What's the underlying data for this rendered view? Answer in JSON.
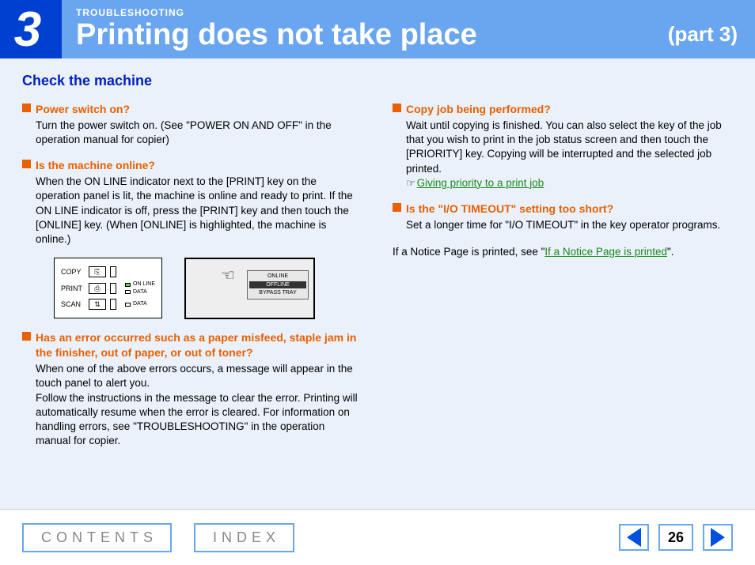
{
  "header": {
    "chapter_number": "3",
    "breadcrumb": "TROUBLESHOOTING",
    "title": "Printing does not take place",
    "part": "(part 3)"
  },
  "subheading": "Check the machine",
  "left_items": [
    {
      "title": "Power switch on?",
      "body": "Turn the power switch on. (See \"POWER ON AND OFF\" in the operation manual for copier)"
    },
    {
      "title": "Is the machine online?",
      "body": "When the ON LINE indicator next to the [PRINT] key on the operation panel is lit, the machine is online and ready to print. If the ON LINE indicator is off, press the [PRINT] key and then touch the [ONLINE] key. (When [ONLINE] is highlighted, the machine is online.)"
    },
    {
      "title": "Has an error occurred such as a paper misfeed, staple jam in the finisher, out of paper, or out of toner?",
      "body": "When one of the above errors occurs, a message will appear in the touch panel to alert you.\nFollow the instructions in the message to clear the error. Printing will automatically resume when the error is cleared. For information on handling errors, see \"TROUBLESHOOTING\" in the operation manual for copier."
    }
  ],
  "right_items": [
    {
      "title": "Copy job being performed?",
      "body": "Wait until copying is finished. You can also select the key of the job that you wish to print in the job status screen and then touch the [PRIORITY] key. Copying will be interrupted and the selected job printed.",
      "link": "Giving priority to a print job"
    },
    {
      "title": "Is the \"I/O TIMEOUT\" setting too short?",
      "body": "Set a longer time for \"I/O TIMEOUT\" in the key operator programs."
    }
  ],
  "right_tail": {
    "prefix": "If a Notice Page is printed, see \"",
    "link": "If a Notice Page is printed",
    "suffix": "\"."
  },
  "panel": {
    "copy": "COPY",
    "print": "PRINT",
    "scan": "SCAN",
    "online_label": "ON LINE",
    "data1": "DATA",
    "data2": "DATA",
    "screen_online": "ONLINE",
    "screen_offline": "OFFLINE",
    "screen_bypass": "BYPASS TRAY"
  },
  "footer": {
    "contents": "CONTENTS",
    "index": "INDEX",
    "page": "26"
  }
}
